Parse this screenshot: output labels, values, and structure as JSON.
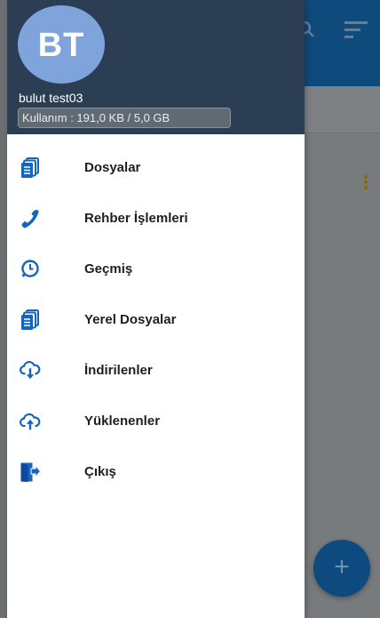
{
  "header": {
    "avatar_initials": "BT",
    "username": "bulut test03",
    "usage": "Kullanım : 191,0 KB /  5,0 GB"
  },
  "menu": {
    "items": [
      {
        "label": "Dosyalar",
        "icon": "files-icon"
      },
      {
        "label": "Rehber İşlemleri",
        "icon": "phone-icon"
      },
      {
        "label": "Geçmiş",
        "icon": "history-icon"
      },
      {
        "label": "Yerel Dosyalar",
        "icon": "local-files-icon"
      },
      {
        "label": "İndirilenler",
        "icon": "cloud-download-icon"
      },
      {
        "label": "Yüklenenler",
        "icon": "cloud-upload-icon"
      },
      {
        "label": "Çıkış",
        "icon": "logout-icon"
      }
    ]
  },
  "background": {
    "fab_label": "+"
  },
  "colors": {
    "accent": "#1565c0",
    "header_bg": "#2c3e54",
    "avatar_bg": "#7ea4db"
  }
}
